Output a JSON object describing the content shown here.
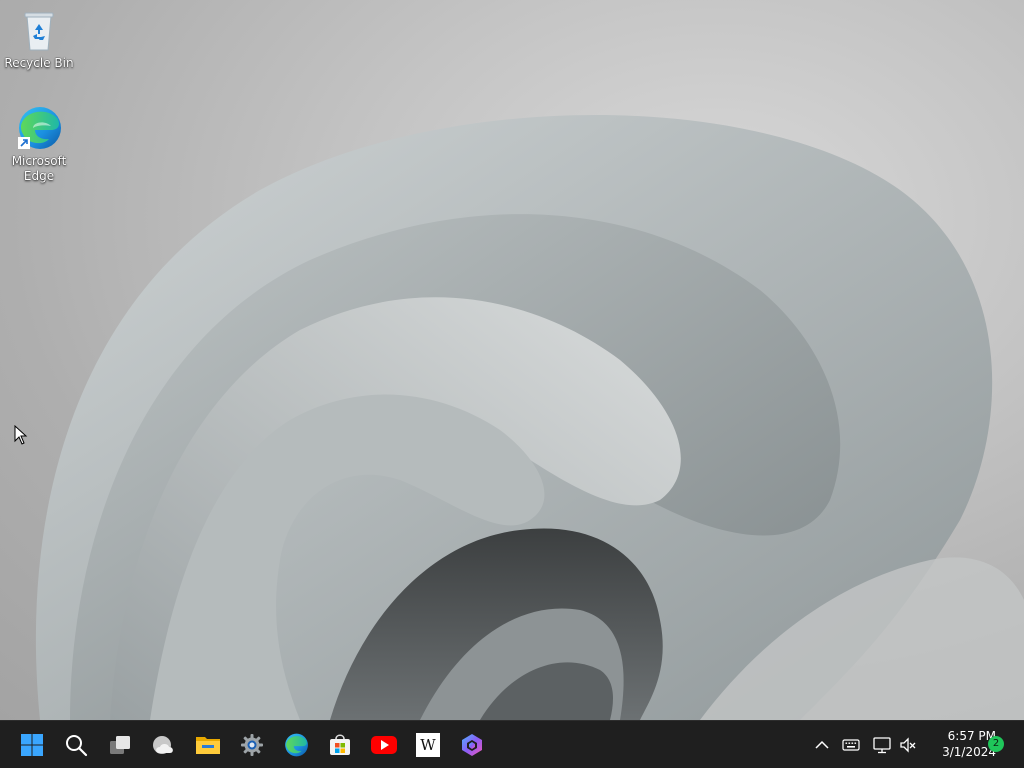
{
  "desktop": {
    "icons": [
      {
        "label": "Recycle Bin",
        "icon": "recycle-bin-icon"
      },
      {
        "label": "Microsoft Edge",
        "icon": "edge-icon"
      }
    ]
  },
  "taskbar": {
    "apps": [
      {
        "name": "Start",
        "icon": "windows-start-icon"
      },
      {
        "name": "Search",
        "icon": "search-icon"
      },
      {
        "name": "Task View",
        "icon": "task-view-icon"
      },
      {
        "name": "Weather",
        "icon": "weather-cloud-icon"
      },
      {
        "name": "File Explorer",
        "icon": "folder-icon"
      },
      {
        "name": "Settings",
        "icon": "gear-icon"
      },
      {
        "name": "Microsoft Edge",
        "icon": "edge-icon"
      },
      {
        "name": "Microsoft Store",
        "icon": "store-icon"
      },
      {
        "name": "YouTube",
        "icon": "youtube-icon"
      },
      {
        "name": "Wikipedia",
        "icon": "wikipedia-icon",
        "glyph": "W"
      },
      {
        "name": "Copilot",
        "icon": "copilot-icon"
      }
    ],
    "tray": {
      "icons": [
        "chevron-up-icon",
        "keyboard-icon",
        "network-icon",
        "volume-muted-icon"
      ],
      "time": "6:57 PM",
      "date": "3/1/2024",
      "notification_count": "2"
    }
  },
  "colors": {
    "taskbar_bg": "#1f1f1f",
    "accent_blue": "#0078d4",
    "badge_green": "#1fc65a",
    "youtube_red": "#ff0000"
  }
}
